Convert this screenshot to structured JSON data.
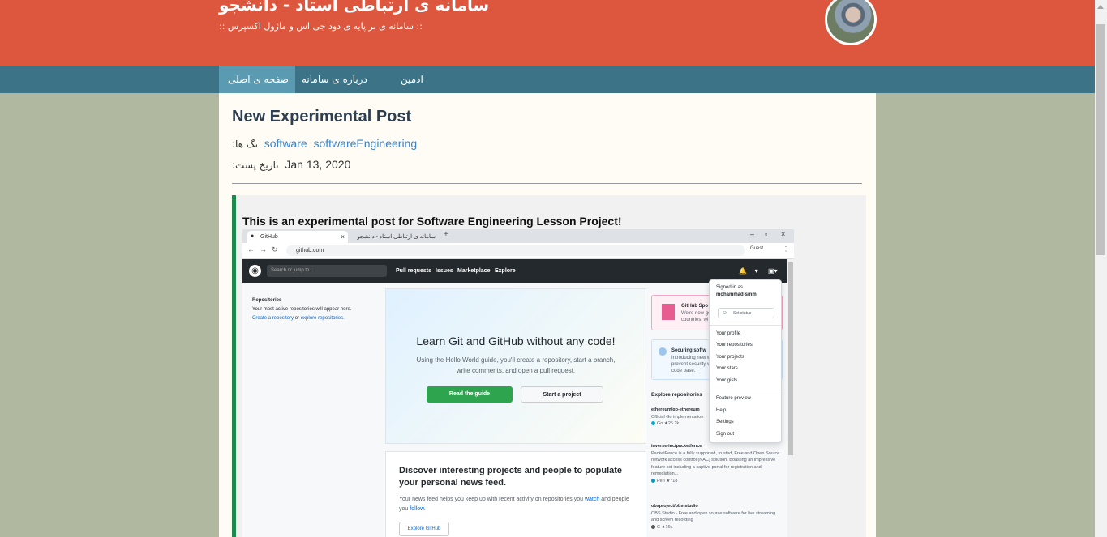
{
  "site": {
    "title": "سامانه ی ارتباطی استاد - دانشجو",
    "subtitle": ":: سامانه ی بر پایه ی دود جی اس و ماژول اکسپرس ::"
  },
  "nav": {
    "home": "صفحه ی اصلی",
    "about": "درباره ی سامانه",
    "admin": "ادمین"
  },
  "post": {
    "title": "New Experimental Post",
    "tags_label": "تگ ها:",
    "tags": [
      "software",
      "softwareEngineering"
    ],
    "date_label": "تاریخ پست:",
    "date": "Jan 13, 2020",
    "body_text": "This is an experimental post for Software Engineering Lesson Project!"
  },
  "screenshot": {
    "tab1": "GitHub",
    "tab2": "سامانه ی ارتباطی استاد - دانشجو",
    "url": "github.com",
    "guest": "Guest",
    "search_placeholder": "Search or jump to...",
    "gh_nav": [
      "Pull requests",
      "Issues",
      "Marketplace",
      "Explore"
    ],
    "repos_heading": "Repositories",
    "repos_text": "Your most active repositories will appear here.",
    "repos_link1": "Create a repository",
    "repos_or": "or",
    "repos_link2": "explore repositories.",
    "hero_title": "Learn Git and GitHub without any code!",
    "hero_desc": "Using the Hello World guide, you'll create a repository, start a branch, write comments, and open a pull request.",
    "btn_guide": "Read the guide",
    "btn_start": "Start a project",
    "discover_title": "Discover interesting projects and people to populate your personal news feed.",
    "discover_text": "Your news feed helps you keep up with recent activity on repositories you",
    "discover_watch": "watch",
    "discover_and": "and people you",
    "discover_follow": "follow.",
    "btn_explore": "Explore GitHub",
    "sponsors_title": "GitHub Spo",
    "sponsors_text": "We're now ge countries, wi",
    "security_title": "Securing softw",
    "security_text": "Introducing new w prevent security w code base.",
    "explore_repos": "Explore repositories",
    "repos": [
      {
        "name": "ethereum/go-ethereum",
        "desc": "Official Go implementation",
        "lang": "Go",
        "stars": "25.2k",
        "color": "#00add8"
      },
      {
        "name": "inverse-inc/packetfence",
        "desc": "PacketFence is a fully supported, trusted, Free and Open Source network access control (NAC) solution. Boasting an impressive feature set including a captive-portal for registration and remediation...",
        "lang": "Perl",
        "stars": "718",
        "color": "#0298c3"
      },
      {
        "name": "obsproject/obs-studio",
        "desc": "OBS Studio - Free and open source software for live streaming and screen recording",
        "lang": "C",
        "stars": "16k",
        "color": "#555555"
      }
    ],
    "dropdown": {
      "signed_in_as": "Signed in as",
      "username": "mohammad-smm",
      "set_status": "Set status",
      "items1": [
        "Your profile",
        "Your repositories",
        "Your projects",
        "Your stars",
        "Your gists"
      ],
      "items2": [
        "Feature preview",
        "Help",
        "Settings",
        "Sign out"
      ]
    }
  }
}
